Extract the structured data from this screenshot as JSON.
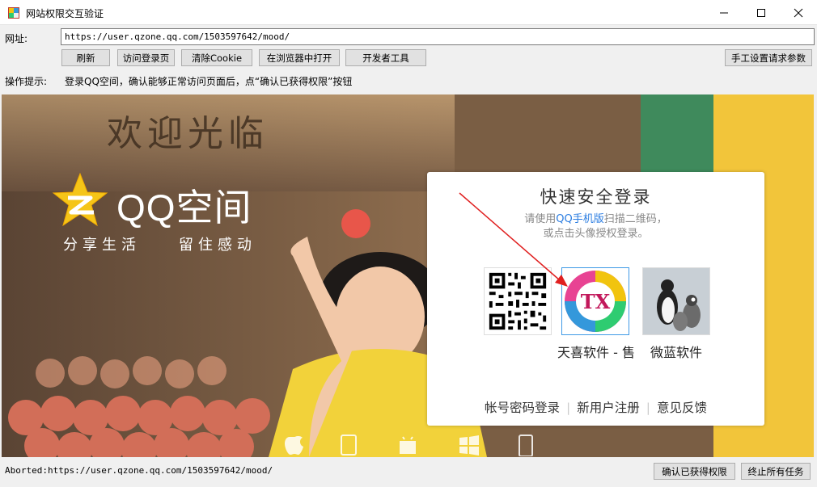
{
  "window": {
    "title": "网站权限交互验证"
  },
  "address": {
    "label": "网址:",
    "url": "https://user.qzone.qq.com/1503597642/mood/"
  },
  "toolbar": {
    "refresh": "刷新",
    "visit_login": "访问登录页",
    "clear_cookie": "清除Cookie",
    "open_in_browser": "在浏览器中打开",
    "dev_tools": "开发者工具",
    "manual_params": "手工设置请求参数"
  },
  "hint": {
    "label": "操作提示:",
    "text": "登录QQ空间，确认能够正常访问页面后，点“确认已获得权限”按钮"
  },
  "page": {
    "banner": "欢迎光临",
    "brand_name": "QQ空间",
    "slogan": "分享生活    留住感动",
    "login": {
      "title": "快速安全登录",
      "subtitle_pre": "请使用",
      "subtitle_link": "QQ手机版",
      "subtitle_post": "扫描二维码，",
      "subtitle_line2": "或点击头像授权登录。",
      "avatar1_name": "天喜软件 - 售",
      "avatar1_badge": "TX",
      "avatar2_name": "微蓝软件",
      "links": [
        "帐号密码登录",
        "新用户注册",
        "意见反馈"
      ]
    }
  },
  "status": {
    "text": "Aborted:https://user.qzone.qq.com/1503597642/mood/"
  },
  "footer": {
    "confirm": "确认已获得权限",
    "stop_all": "终止所有任务"
  },
  "colors": {
    "accent": "#2b7de1",
    "arrow": "#e02020",
    "panel_highlight": "#3f9ae6",
    "yellow_wall": "#f2c53a"
  }
}
